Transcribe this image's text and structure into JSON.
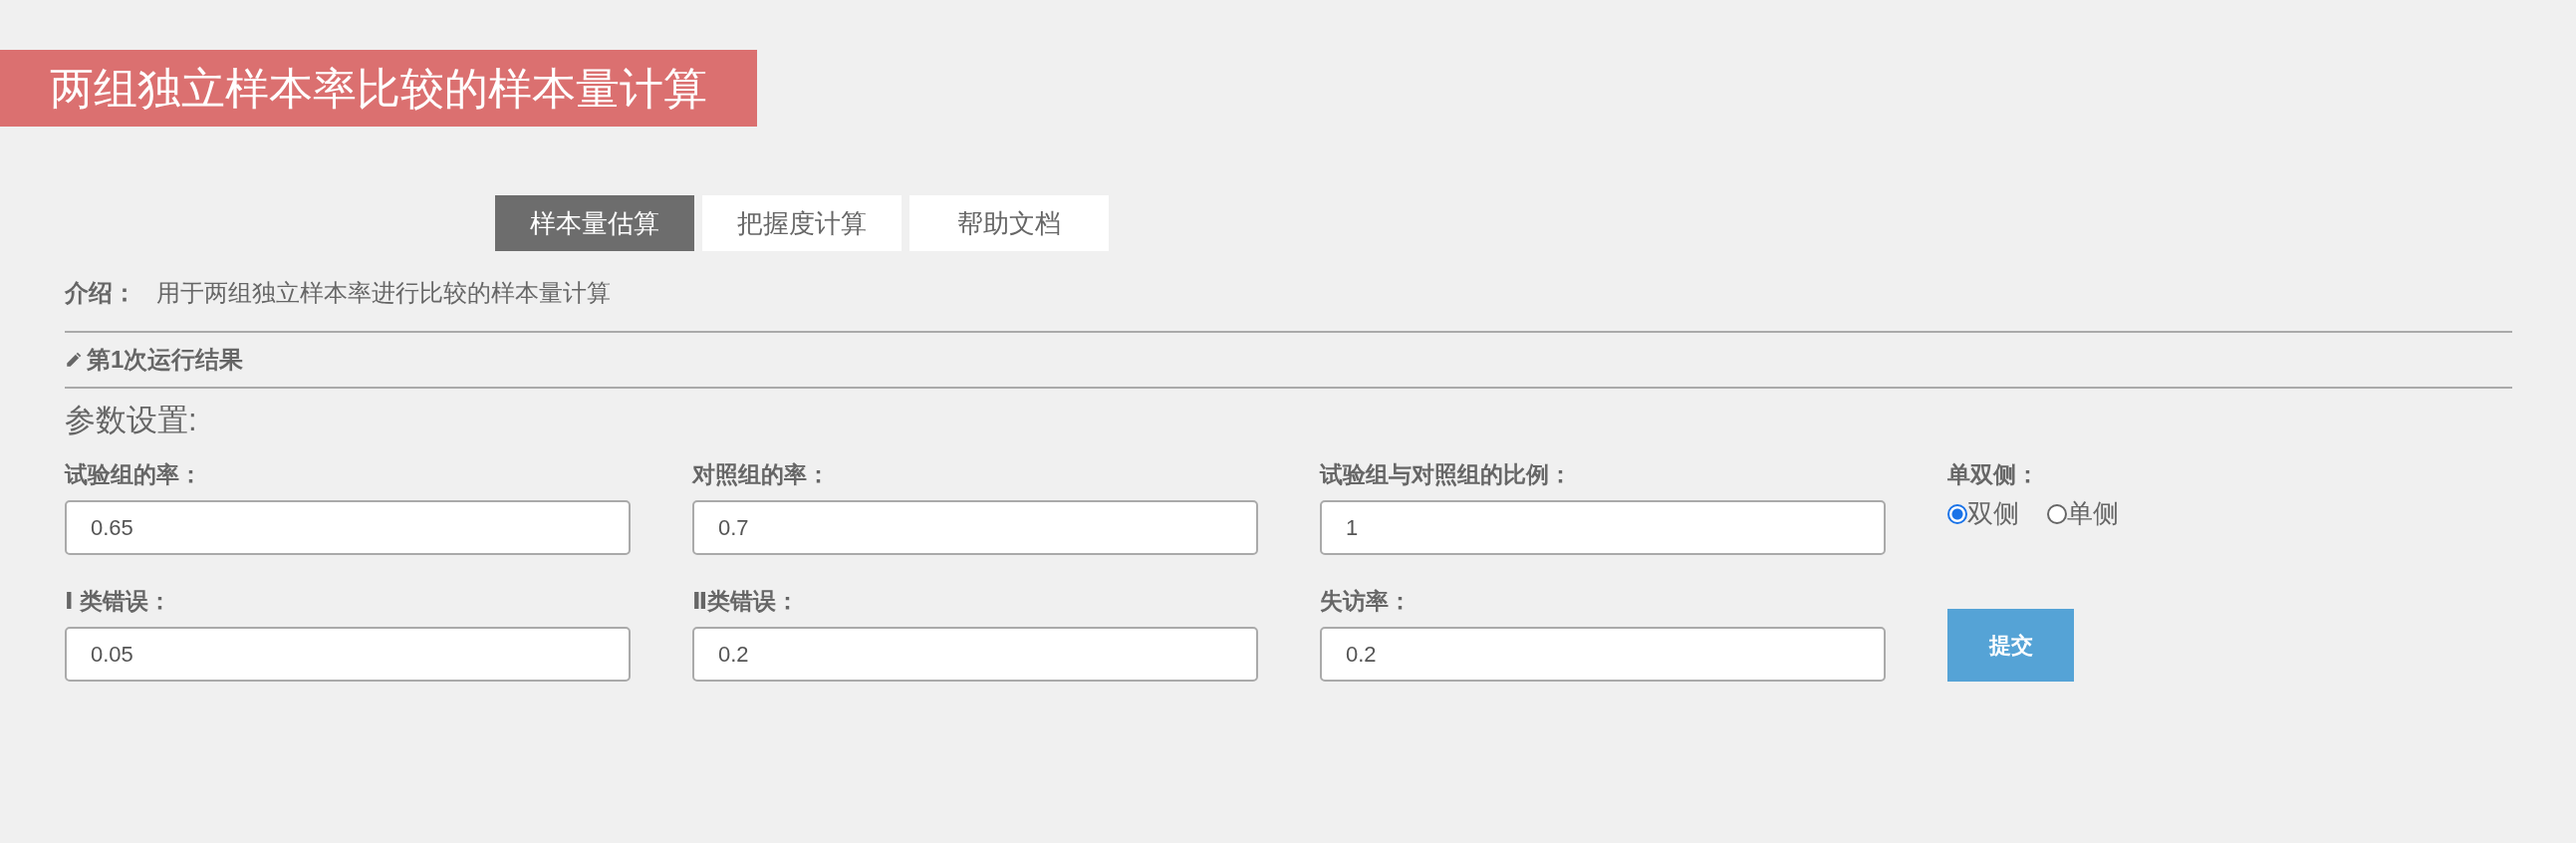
{
  "title": "两组独立样本率比较的样本量计算",
  "tabs": [
    {
      "label": "样本量估算",
      "selected": true
    },
    {
      "label": "把握度计算",
      "selected": false
    },
    {
      "label": "帮助文档",
      "selected": false
    }
  ],
  "intro": {
    "label": "介绍：",
    "text": "用于两组独立样本率进行比较的样本量计算"
  },
  "result_heading": "第1次运行结果",
  "section_title": "参数设置:",
  "fields": [
    {
      "label": "试验组的率：",
      "value": "0.65"
    },
    {
      "label": "对照组的率：",
      "value": "0.7"
    },
    {
      "label": "试验组与对照组的比例：",
      "value": "1"
    },
    {
      "label": "Ⅰ 类错误：",
      "value": "0.05"
    },
    {
      "label": "Ⅱ类错误：",
      "value": "0.2"
    },
    {
      "label": "失访率：",
      "value": "0.2"
    }
  ],
  "sides": {
    "label": "单双侧：",
    "options": [
      {
        "label": "双侧",
        "selected": true
      },
      {
        "label": "单侧",
        "selected": false
      }
    ]
  },
  "submit": "提交"
}
